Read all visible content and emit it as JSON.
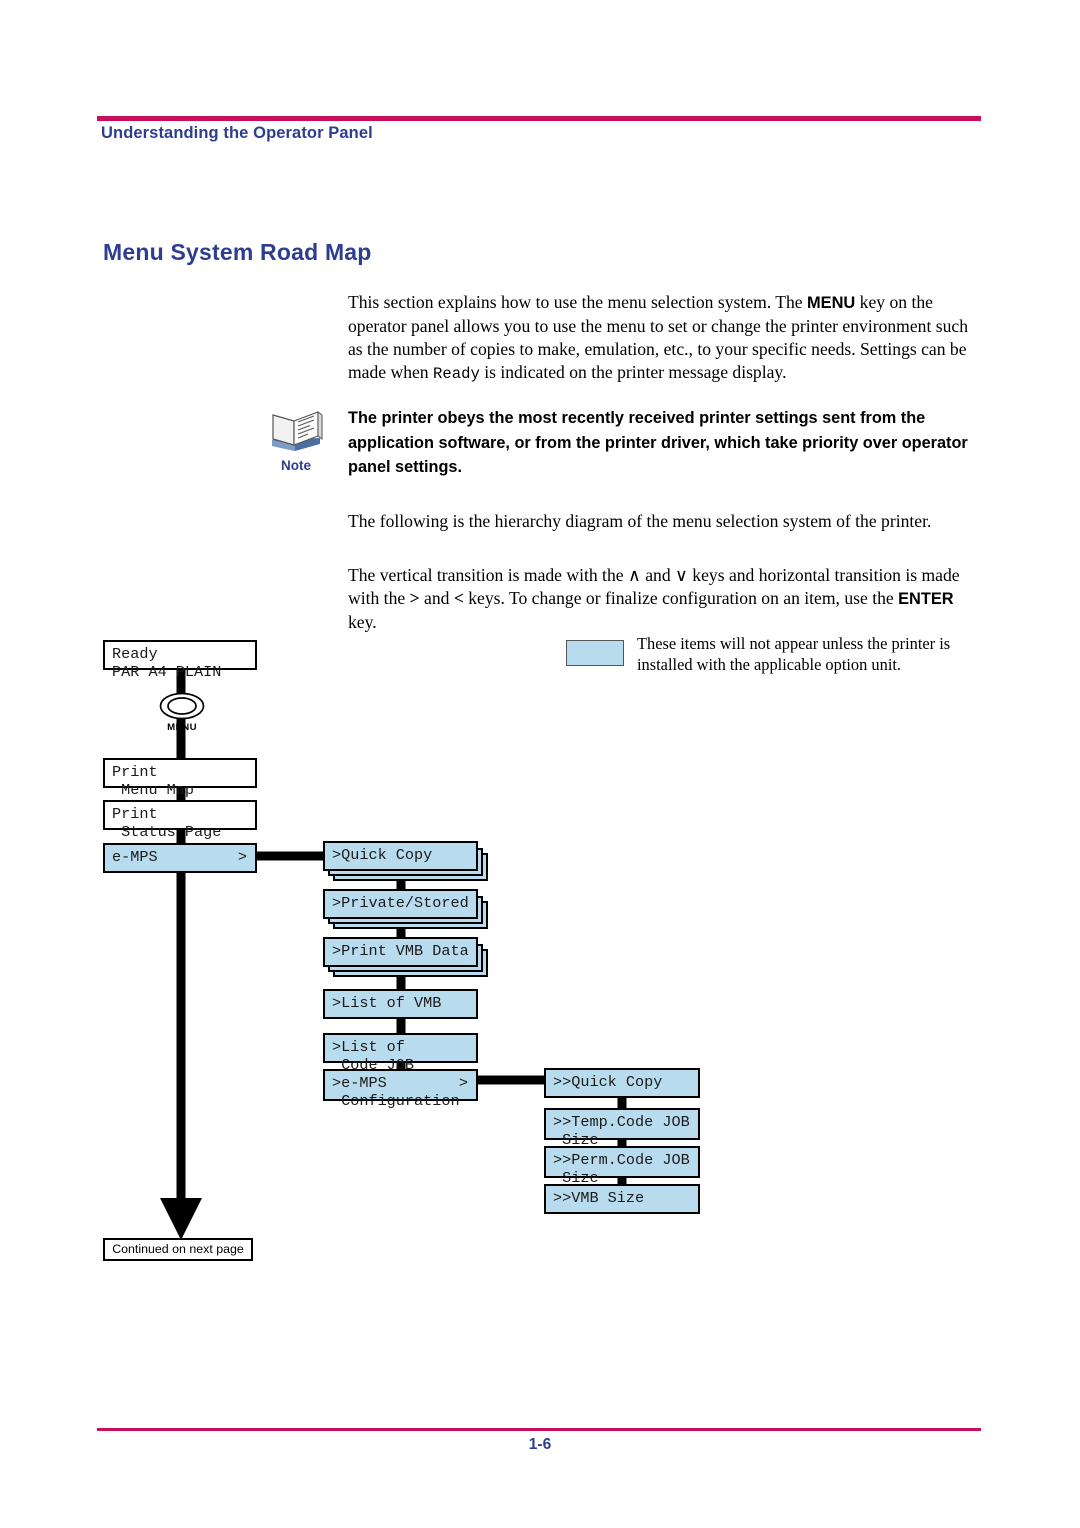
{
  "page": {
    "running_head": "Understanding the Operator Panel",
    "section_title": "Menu System Road Map",
    "page_number": "1-6",
    "rule_color": "#c8105a",
    "heading_color": "#2e3e8f",
    "option_box_color": "#b8dced"
  },
  "body": {
    "intro_html": "This section explains how to use the menu selection system. The <span class=\"kb\">MENU</span> key on the operator panel allows you to use the menu to set or change the printer environment such as the number of copies to make, emulation, etc., to your specific needs. Settings can be made when <span class=\"mono\">Ready</span> is indicated on the printer message display.",
    "hierarchy_html": "The following is the hierarchy diagram of the menu selection system of the printer.",
    "transition_html": "The vertical transition is made with the &#8743; and &#8744; keys and horizontal transition is made with the <b>&gt;</b> and <b>&lt;</b> keys. To change or finalize configuration on an item, use the <span class=\"kb\">ENTER</span> key."
  },
  "note": {
    "label": "Note",
    "text": "The printer obeys the most recently received printer settings sent from the application software, or from the printer driver, which take priority over operator panel settings."
  },
  "legend": {
    "text": "These items will not appear unless the printer is installed with the applicable option unit."
  },
  "diagram": {
    "menu_key_label": "MENU",
    "continued_label": "Continued on next page",
    "column1": [
      {
        "line1": "Ready",
        "line2": "PAR A4 PLAIN",
        "option": false,
        "arrow": ""
      },
      {
        "line1": "Print",
        "line2": " Menu Map",
        "option": false,
        "arrow": ""
      },
      {
        "line1": "Print",
        "line2": " Status Page",
        "option": false,
        "arrow": ""
      },
      {
        "line1": "e-MPS",
        "line2": "",
        "option": true,
        "arrow": ">"
      }
    ],
    "column2": [
      {
        "line1": ">Quick Copy",
        "line2": "",
        "option": true,
        "arrow": "",
        "stacked": true
      },
      {
        "line1": ">Private/Stored",
        "line2": "",
        "option": true,
        "arrow": "",
        "stacked": true
      },
      {
        "line1": ">Print VMB Data",
        "line2": "",
        "option": true,
        "arrow": "",
        "stacked": true
      },
      {
        "line1": ">List of VMB",
        "line2": "",
        "option": true,
        "arrow": "",
        "stacked": false
      },
      {
        "line1": ">List of",
        "line2": " Code JOB",
        "option": true,
        "arrow": "",
        "stacked": false
      },
      {
        "line1": ">e-MPS",
        "line2": " Configuration",
        "option": true,
        "arrow": ">",
        "stacked": false
      }
    ],
    "column3": [
      {
        "line1": ">>Quick Copy",
        "line2": "",
        "option": true,
        "arrow": ""
      },
      {
        "line1": ">>Temp.Code JOB",
        "line2": " Size",
        "option": true,
        "arrow": ""
      },
      {
        "line1": ">>Perm.Code JOB",
        "line2": " Size",
        "option": true,
        "arrow": ""
      },
      {
        "line1": ">>VMB Size",
        "line2": "",
        "option": true,
        "arrow": ""
      }
    ]
  }
}
